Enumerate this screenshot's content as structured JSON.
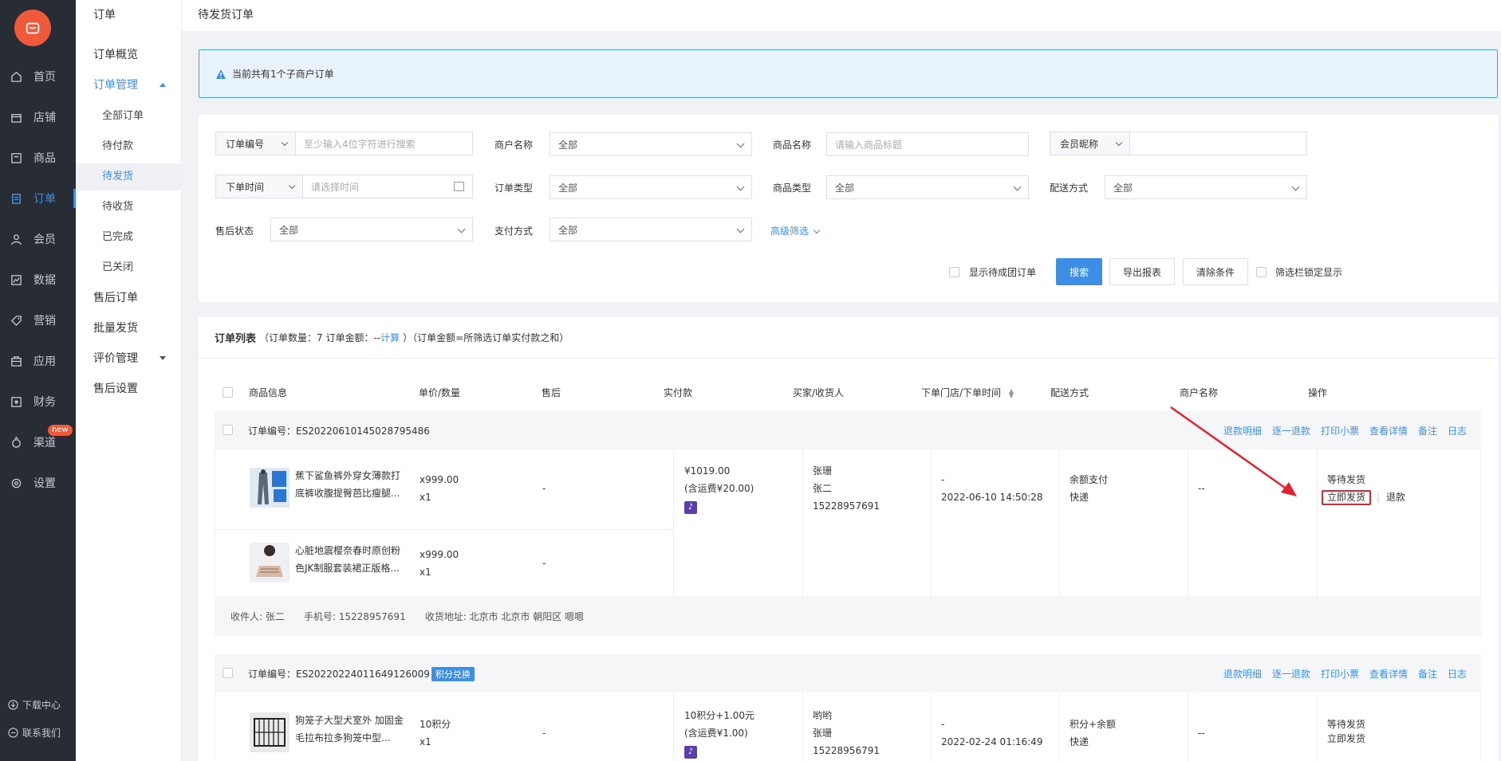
{
  "nav": {
    "items": [
      {
        "label": "首页",
        "icon": "home-icon"
      },
      {
        "label": "店铺",
        "icon": "store-icon"
      },
      {
        "label": "商品",
        "icon": "goods-icon"
      },
      {
        "label": "订单",
        "icon": "order-icon"
      },
      {
        "label": "会员",
        "icon": "user-icon"
      },
      {
        "label": "数据",
        "icon": "chart-icon"
      },
      {
        "label": "营销",
        "icon": "tag-icon"
      },
      {
        "label": "应用",
        "icon": "app-icon"
      },
      {
        "label": "财务",
        "icon": "finance-icon"
      },
      {
        "label": "渠道",
        "icon": "channel-icon"
      },
      {
        "label": "设置",
        "icon": "gear-icon"
      }
    ],
    "new_badge": "new",
    "download": "下载中心",
    "contact": "联系我们"
  },
  "subnav": {
    "title": "订单",
    "items": [
      "订单概览",
      "订单管理",
      "全部订单",
      "待付款",
      "待发货",
      "待收货",
      "已完成",
      "已关闭",
      "售后订单",
      "批量发货",
      "评价管理",
      "售后设置"
    ]
  },
  "topbar": {
    "title": "待发货订单"
  },
  "notice": {
    "text": "当前共有1个子商户订单"
  },
  "filters": {
    "order_no_type": "订单编号",
    "order_no_placeholder": "至少输入4位字符进行搜索",
    "merchant_label": "商户名称",
    "merchant_value": "全部",
    "goods_name_label": "商品名称",
    "goods_name_placeholder": "请输入商品标题",
    "member_type": "会员昵称",
    "time_type": "下单时间",
    "time_placeholder": "请选择时间",
    "order_type_label": "订单类型",
    "order_type_value": "全部",
    "goods_type_label": "商品类型",
    "goods_type_value": "全部",
    "delivery_label": "配送方式",
    "delivery_value": "全部",
    "aftersale_label": "售后状态",
    "aftersale_value": "全部",
    "pay_label": "支付方式",
    "pay_value": "全部",
    "advanced": "高级筛选",
    "show_group": "显示待成团订单",
    "search_btn": "搜索",
    "export_btn": "导出报表",
    "clear_btn": "清除条件",
    "lock_filter": "筛选栏锁定显示"
  },
  "list": {
    "title": "订单列表",
    "summary_prefix": "（订单数量：7 订单金额：-- ",
    "calc_link": "计算",
    "summary_suffix": "）（订单金额=所筛选订单实付款之和）",
    "columns": [
      "商品信息",
      "单价/数量",
      "售后",
      "实付款",
      "买家/收货人",
      "下单门店/下单时间",
      "配送方式",
      "商户名称",
      "操作"
    ],
    "ops": [
      "退款明细",
      "逐一退款",
      "打印小票",
      "查看详情",
      "备注",
      "日志"
    ]
  },
  "orders": [
    {
      "order_no": "订单编号：ES20220610145028795486",
      "items": [
        {
          "name": "蕉下鲨鱼裤外穿女薄款打底裤收腹提臀芭比瘦腿...",
          "price": "x999.00",
          "qty": "x1",
          "aftersale": "-"
        },
        {
          "name": "心脏地震樱奈春时原创粉色JK制服套装裙正版格...",
          "price": "x999.00",
          "qty": "x1",
          "aftersale": "-"
        }
      ],
      "paid": "¥1019.00",
      "shipping_fee": "(含运费¥20.00)",
      "buyer_link": "张珊",
      "receiver": "张二",
      "phone": "15228957691",
      "store": "-",
      "time": "2022-06-10 14:50:28",
      "pay_method": "余额支付",
      "delivery": "快递",
      "merchant": "--",
      "status": "等待发货",
      "ship_link": "立即发货",
      "refund_link": "退款",
      "addr_receiver": "收件人: 张二",
      "addr_phone": "手机号: 15228957691",
      "addr_address": "收货地址: 北京市 北京市 朝阳区 嗯嗯"
    },
    {
      "order_no": "订单编号：ES20220224011649126009",
      "tag": "积分兑换",
      "items": [
        {
          "name": "狗笼子大型犬室外 加固金毛拉布拉多狗笼中型...",
          "price": "10积分",
          "qty": "x1",
          "aftersale": "-"
        }
      ],
      "paid": "10积分+1.00元",
      "shipping_fee": "(含运费¥1.00)",
      "buyer_link": "哟哟",
      "receiver": "张珊",
      "phone": "15228956791",
      "store": "-",
      "time": "2022-02-24 01:16:49",
      "pay_method": "积分+余额",
      "delivery": "快递",
      "merchant": "--",
      "status": "等待发货",
      "ship_link": "立即发货"
    }
  ],
  "colors": {
    "accent": "#3d8fe6",
    "sidebar": "#282c34",
    "logo": "#f0593a",
    "highlight": "#e5212d"
  }
}
